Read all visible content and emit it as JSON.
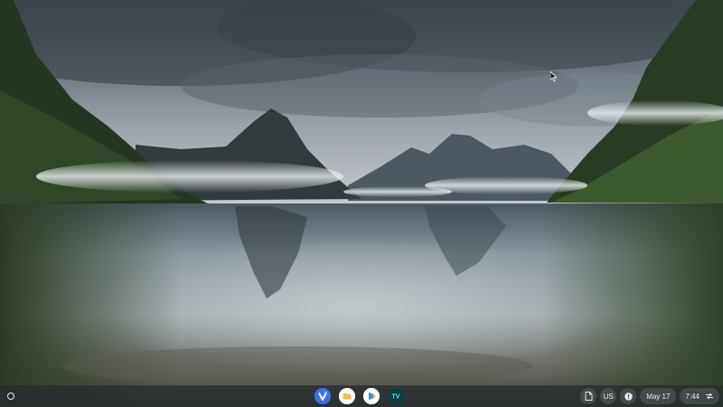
{
  "desktop": {
    "wallpaper": "milford-sound-landscape",
    "cursor_icon": "mouse-pointer-icon"
  },
  "shelf": {
    "launcher_icon": "launcher-icon",
    "apps": [
      {
        "id": "vpn",
        "icon": "vpn-app-icon",
        "label": "V"
      },
      {
        "id": "files",
        "icon": "files-folder-icon"
      },
      {
        "id": "play-store",
        "icon": "play-store-icon"
      },
      {
        "id": "tv",
        "icon": "tv-app-icon",
        "label": "TV"
      }
    ],
    "status": {
      "holding_space_icon": "document-icon",
      "ime_label": "US",
      "notification_icon": "do-not-disturb-icon",
      "date": "May 17",
      "time": "7:44",
      "network_icon": "network-arrows-icon"
    }
  },
  "colors": {
    "shelf_bg": "#262a2e",
    "pill_bg": "#3c4043",
    "text": "#e8eaed",
    "vpn_blue": "#3d6ef0",
    "folder_yellow": "#f3c13a",
    "tv_teal": "#0f5e62"
  }
}
